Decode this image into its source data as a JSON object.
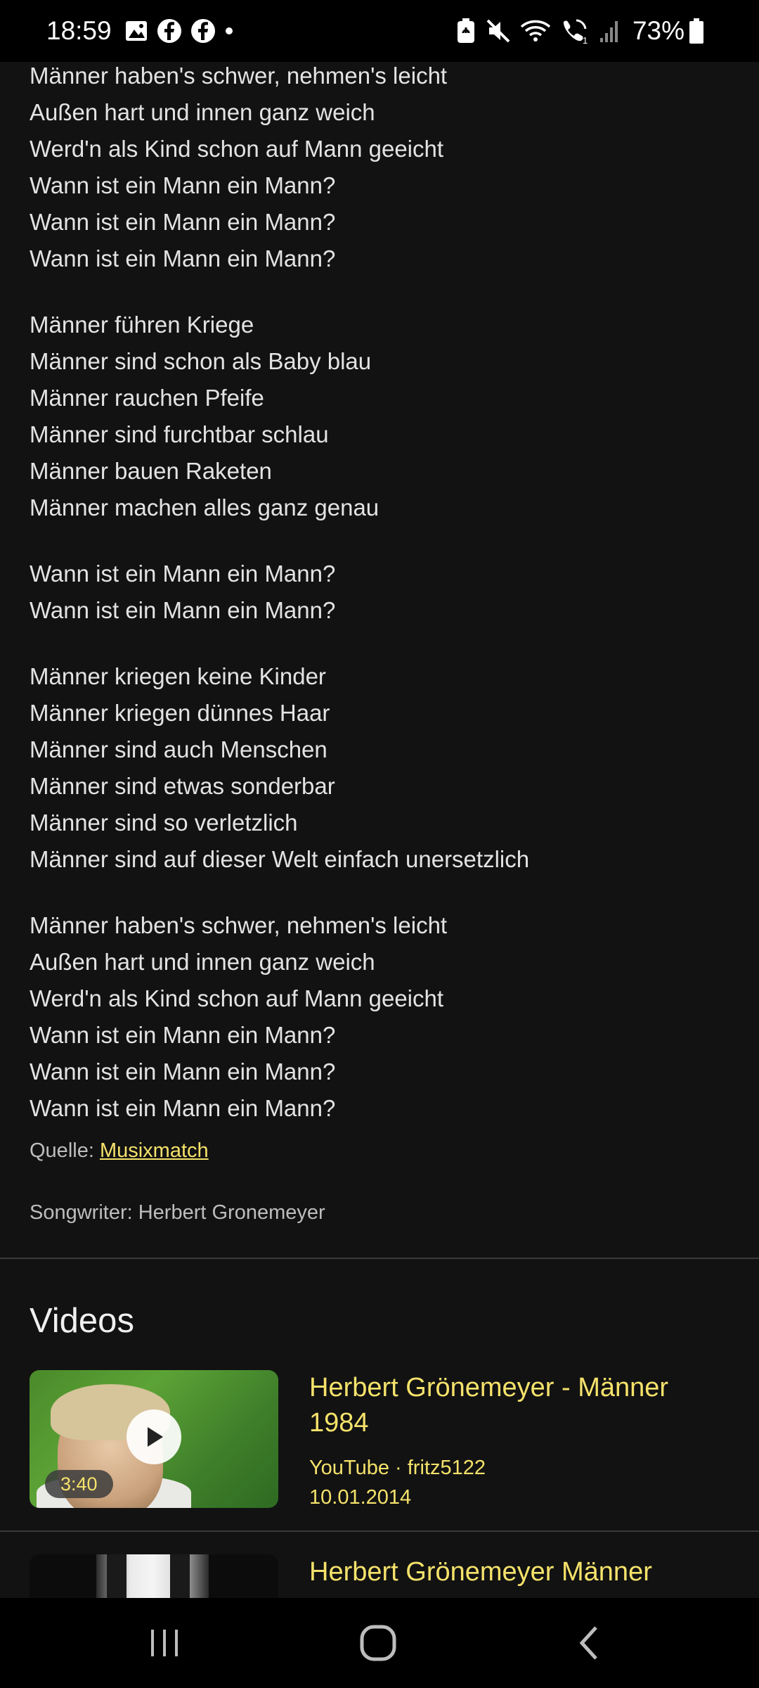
{
  "status_bar": {
    "time": "18:59",
    "battery": "73%",
    "left_icons": [
      "gallery-icon",
      "facebook-icon",
      "facebook-icon",
      "dot-icon"
    ],
    "right_icons": [
      "battery-saver-icon",
      "mute-icon",
      "wifi-icon",
      "wifi-calling-icon",
      "signal-icon",
      "battery-icon"
    ]
  },
  "lyrics": {
    "stanzas": [
      [
        "Männer haben's schwer, nehmen's leicht",
        "Außen hart und innen ganz weich",
        "Werd'n als Kind schon auf Mann geeicht",
        "Wann ist ein Mann ein Mann?",
        "Wann ist ein Mann ein Mann?",
        "Wann ist ein Mann ein Mann?"
      ],
      [
        "Männer führen Kriege",
        "Männer sind schon als Baby blau",
        "Männer rauchen Pfeife",
        "Männer sind furchtbar schlau",
        "Männer bauen Raketen",
        "Männer machen alles ganz genau"
      ],
      [
        "Wann ist ein Mann ein Mann?",
        "Wann ist ein Mann ein Mann?"
      ],
      [
        "Männer kriegen keine Kinder",
        "Männer kriegen dünnes Haar",
        "Männer sind auch Menschen",
        "Männer sind etwas sonderbar",
        "Männer sind so verletzlich",
        "Männer sind auf dieser Welt einfach unersetzlich"
      ],
      [
        "Männer haben's schwer, nehmen's leicht",
        "Außen hart und innen ganz weich",
        "Werd'n als Kind schon auf Mann geeicht",
        "Wann ist ein Mann ein Mann?",
        "Wann ist ein Mann ein Mann?",
        "Wann ist ein Mann ein Mann?"
      ]
    ],
    "source_label": "Quelle:",
    "source_link": "Musixmatch",
    "songwriter": "Songwriter: Herbert Gronemeyer"
  },
  "videos": {
    "section_title": "Videos",
    "items": [
      {
        "title": "Herbert Grönemeyer - Männer 1984",
        "source": "YouTube · fritz5122",
        "date": "10.01.2014",
        "duration": "3:40"
      },
      {
        "title": "Herbert Grönemeyer Männer"
      }
    ]
  },
  "colors": {
    "background": "#121212",
    "accent": "#f5e26b",
    "text": "#e3e3e3"
  },
  "nav_bar": {
    "buttons": [
      "recents-icon",
      "home-icon",
      "back-icon"
    ]
  }
}
